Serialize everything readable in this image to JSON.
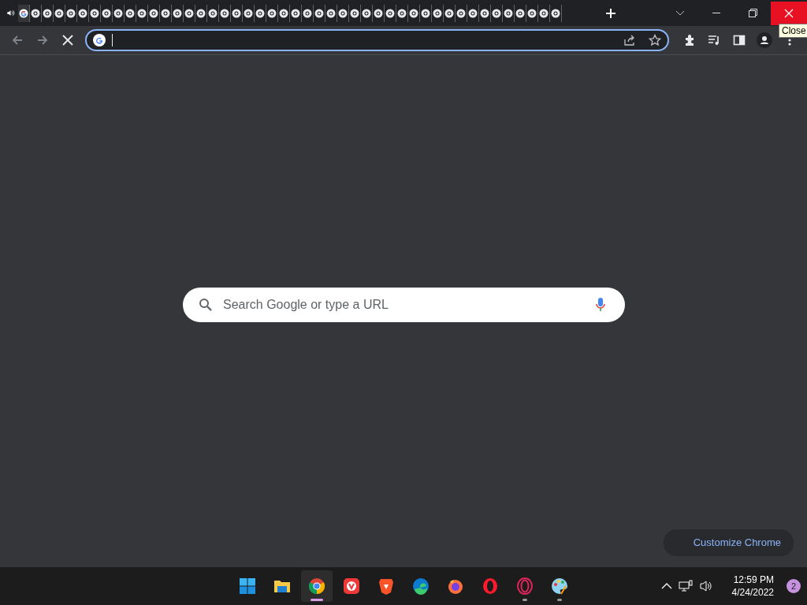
{
  "tabs": [
    {
      "kind": "google",
      "selected": true,
      "audio": true
    },
    {
      "kind": "chrome",
      "selected": false,
      "audio": false
    },
    {
      "kind": "chrome",
      "selected": false,
      "audio": false
    },
    {
      "kind": "chrome",
      "selected": false,
      "audio": false
    },
    {
      "kind": "chrome",
      "selected": false,
      "audio": false
    },
    {
      "kind": "chrome",
      "selected": false,
      "audio": false
    },
    {
      "kind": "chrome",
      "selected": false,
      "audio": false
    },
    {
      "kind": "chrome",
      "selected": false,
      "audio": false
    },
    {
      "kind": "chrome",
      "selected": false,
      "audio": false
    },
    {
      "kind": "chrome",
      "selected": false,
      "audio": false
    },
    {
      "kind": "chrome",
      "selected": false,
      "audio": false
    },
    {
      "kind": "chrome",
      "selected": false,
      "audio": false
    },
    {
      "kind": "chrome",
      "selected": false,
      "audio": false
    },
    {
      "kind": "chrome",
      "selected": false,
      "audio": false
    },
    {
      "kind": "chrome",
      "selected": false,
      "audio": false
    },
    {
      "kind": "chrome",
      "selected": false,
      "audio": false
    },
    {
      "kind": "chrome",
      "selected": false,
      "audio": false
    },
    {
      "kind": "chrome",
      "selected": false,
      "audio": false
    },
    {
      "kind": "chrome",
      "selected": false,
      "audio": false
    },
    {
      "kind": "chrome",
      "selected": false,
      "audio": false
    },
    {
      "kind": "chrome",
      "selected": false,
      "audio": false
    },
    {
      "kind": "chrome",
      "selected": false,
      "audio": false
    },
    {
      "kind": "chrome",
      "selected": false,
      "audio": false
    },
    {
      "kind": "chrome",
      "selected": false,
      "audio": false
    },
    {
      "kind": "chrome",
      "selected": false,
      "audio": false
    },
    {
      "kind": "chrome",
      "selected": false,
      "audio": false
    },
    {
      "kind": "chrome",
      "selected": false,
      "audio": false
    },
    {
      "kind": "chrome",
      "selected": false,
      "audio": false
    },
    {
      "kind": "chrome",
      "selected": false,
      "audio": false
    },
    {
      "kind": "chrome",
      "selected": false,
      "audio": false
    },
    {
      "kind": "chrome",
      "selected": false,
      "audio": false
    },
    {
      "kind": "chrome",
      "selected": false,
      "audio": false
    },
    {
      "kind": "chrome",
      "selected": false,
      "audio": false
    },
    {
      "kind": "chrome",
      "selected": false,
      "audio": false
    },
    {
      "kind": "chrome",
      "selected": false,
      "audio": false
    },
    {
      "kind": "chrome",
      "selected": false,
      "audio": false
    },
    {
      "kind": "chrome",
      "selected": false,
      "audio": false
    },
    {
      "kind": "chrome",
      "selected": false,
      "audio": false
    },
    {
      "kind": "chrome",
      "selected": false,
      "audio": false
    },
    {
      "kind": "chrome",
      "selected": false,
      "audio": false
    },
    {
      "kind": "chrome",
      "selected": false,
      "audio": false
    },
    {
      "kind": "chrome",
      "selected": false,
      "audio": false
    },
    {
      "kind": "chrome",
      "selected": false,
      "audio": false
    },
    {
      "kind": "chrome",
      "selected": false,
      "audio": false
    },
    {
      "kind": "chrome",
      "selected": false,
      "audio": false
    },
    {
      "kind": "chrome",
      "selected": false,
      "audio": false
    }
  ],
  "tooltip": "Close",
  "search": {
    "placeholder": "Search Google or type a URL"
  },
  "customize_button": "Customize Chrome",
  "taskbar": {
    "apps": [
      {
        "kind": "start",
        "running": false,
        "active": false
      },
      {
        "kind": "folder",
        "running": false,
        "active": false
      },
      {
        "kind": "chrome",
        "running": true,
        "active": true
      },
      {
        "kind": "vivaldi",
        "running": false,
        "active": false
      },
      {
        "kind": "brave",
        "running": false,
        "active": false
      },
      {
        "kind": "edge",
        "running": false,
        "active": false
      },
      {
        "kind": "firefox",
        "running": false,
        "active": false
      },
      {
        "kind": "opera",
        "running": false,
        "active": false
      },
      {
        "kind": "operagx",
        "running": true,
        "active": false
      },
      {
        "kind": "paint",
        "running": true,
        "active": false
      }
    ],
    "time": "12:59 PM",
    "date": "4/24/2022",
    "notifications": "2"
  }
}
